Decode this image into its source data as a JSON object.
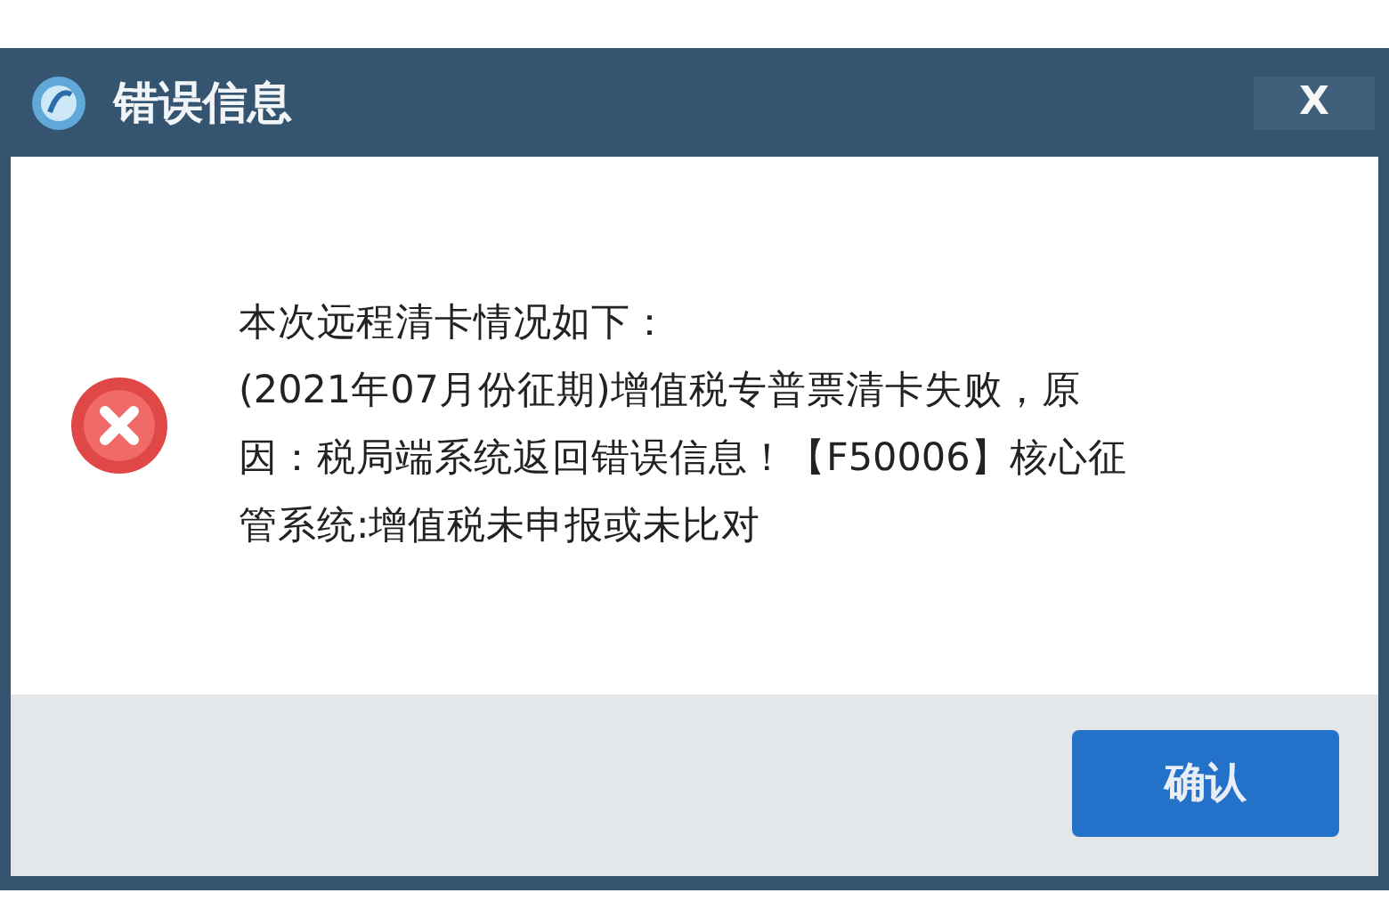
{
  "window": {
    "title": "错误信息",
    "close": "X"
  },
  "message": {
    "kind": "error",
    "lines": [
      "本次远程清卡情况如下：",
      "(2021年07月份征期)增值税专普票清卡失败，原",
      "因：税局端系统返回错误信息！【F50006】核心征",
      "管系统:增值税未申报或未比对"
    ]
  },
  "buttons": [
    "确认"
  ]
}
